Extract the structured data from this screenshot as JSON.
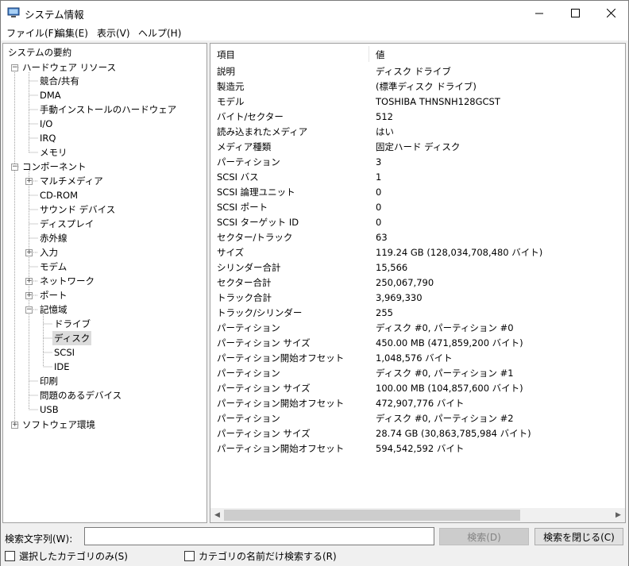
{
  "window": {
    "title": "システム情報"
  },
  "menu": {
    "items": [
      {
        "label": "ファイル(F)"
      },
      {
        "label": "編集(E)"
      },
      {
        "label": "表示(V)"
      },
      {
        "label": "ヘルプ(H)"
      }
    ]
  },
  "tree": {
    "root": "システムの要約",
    "hardware": "ハードウェア リソース",
    "hardware_children": [
      "競合/共有",
      "DMA",
      "手動インストールのハードウェア",
      "I/O",
      "IRQ",
      "メモリ"
    ],
    "components": "コンポーネント",
    "multimedia": "マルチメディア",
    "cdrom": "CD-ROM",
    "sound": "サウンド デバイス",
    "display": "ディスプレイ",
    "infrared": "赤外線",
    "input": "入力",
    "modem": "モデム",
    "network": "ネットワーク",
    "ports": "ポート",
    "storage": "記憶域",
    "storage_children": [
      "ドライブ",
      "ディスク",
      "SCSI",
      "IDE"
    ],
    "printing": "印刷",
    "problem_devices": "問題のあるデバイス",
    "usb": "USB",
    "software": "ソフトウェア環境"
  },
  "details": {
    "header_item": "項目",
    "header_value": "値",
    "rows": [
      {
        "item": "説明",
        "value": "ディスク ドライブ"
      },
      {
        "item": "製造元",
        "value": "(標準ディスク ドライブ)"
      },
      {
        "item": "モデル",
        "value": "TOSHIBA THNSNH128GCST"
      },
      {
        "item": "バイト/セクター",
        "value": "512"
      },
      {
        "item": "読み込まれたメディア",
        "value": "はい"
      },
      {
        "item": "メディア種類",
        "value": "固定ハード ディスク"
      },
      {
        "item": "パーティション",
        "value": "3"
      },
      {
        "item": "SCSI バス",
        "value": "1"
      },
      {
        "item": "SCSI 論理ユニット",
        "value": "0"
      },
      {
        "item": "SCSI ポート",
        "value": "0"
      },
      {
        "item": "SCSI ターゲット ID",
        "value": "0"
      },
      {
        "item": "セクター/トラック",
        "value": "63"
      },
      {
        "item": "サイズ",
        "value": "119.24 GB (128,034,708,480 バイト)"
      },
      {
        "item": "シリンダー合計",
        "value": "15,566"
      },
      {
        "item": "セクター合計",
        "value": "250,067,790"
      },
      {
        "item": "トラック合計",
        "value": "3,969,330"
      },
      {
        "item": "トラック/シリンダー",
        "value": "255"
      },
      {
        "item": "パーティション",
        "value": "ディスク #0, パーティション #0"
      },
      {
        "item": "パーティション サイズ",
        "value": "450.00 MB (471,859,200 バイト)"
      },
      {
        "item": "パーティション開始オフセット",
        "value": "1,048,576 バイト"
      },
      {
        "item": "パーティション",
        "value": "ディスク #0, パーティション #1"
      },
      {
        "item": "パーティション サイズ",
        "value": "100.00 MB (104,857,600 バイト)"
      },
      {
        "item": "パーティション開始オフセット",
        "value": "472,907,776 バイト"
      },
      {
        "item": "パーティション",
        "value": "ディスク #0, パーティション #2"
      },
      {
        "item": "パーティション サイズ",
        "value": "28.74 GB (30,863,785,984 バイト)"
      },
      {
        "item": "パーティション開始オフセット",
        "value": "594,542,592 バイト"
      }
    ]
  },
  "search": {
    "label": "検索文字列(W):",
    "value": "",
    "search_button": "検索(D)",
    "close_button": "検索を閉じる(C)",
    "checkbox_selected_only": "選択したカテゴリのみ(S)",
    "checkbox_names_only": "カテゴリの名前だけ検索する(R)"
  }
}
